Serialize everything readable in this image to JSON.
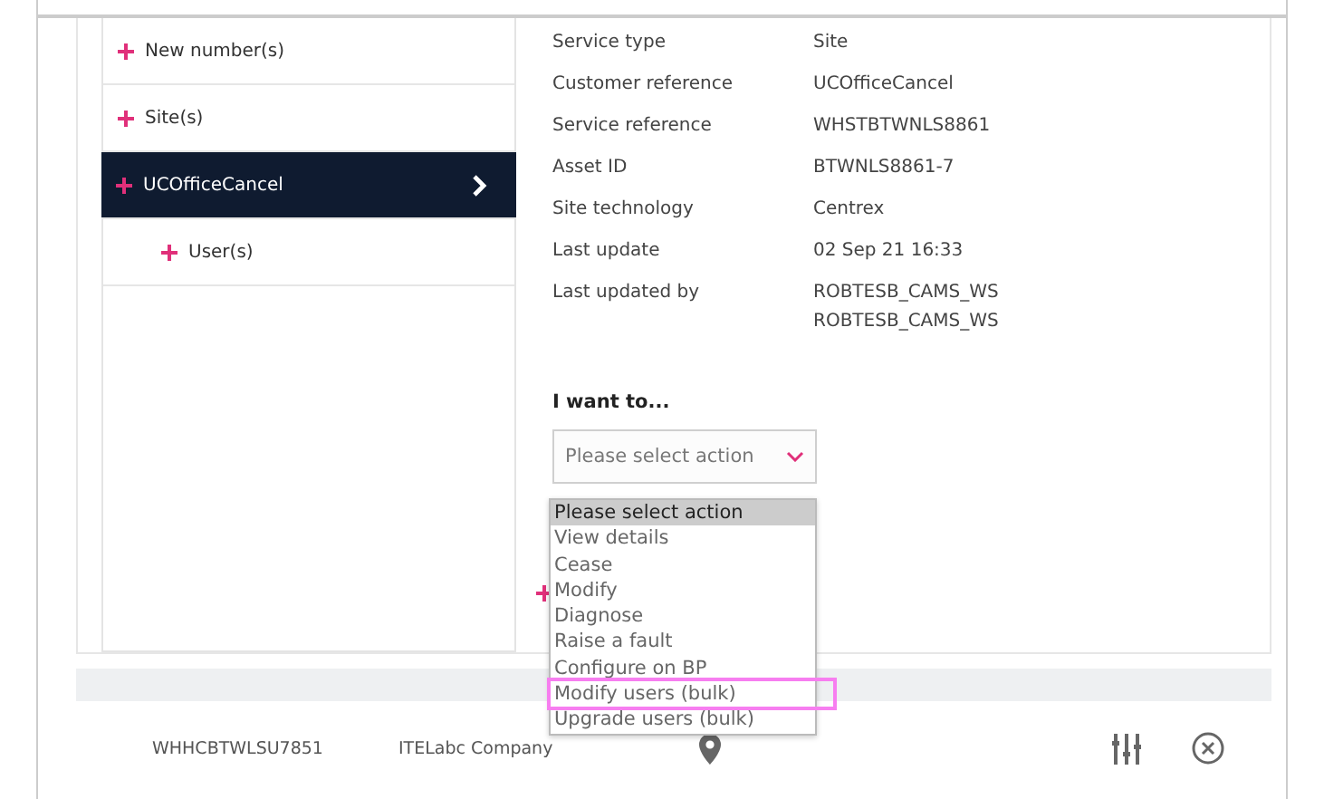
{
  "sidebar": {
    "items": [
      {
        "label": "New number(s)",
        "selected": false
      },
      {
        "label": "Site(s)",
        "selected": false
      },
      {
        "label": "UCOfficeCancel",
        "selected": true,
        "children": [
          {
            "label": "User(s)",
            "selected": false
          }
        ]
      }
    ]
  },
  "details": [
    {
      "label": "Service type",
      "value": [
        "Site"
      ]
    },
    {
      "label": "Customer reference",
      "value": [
        "UCOfficeCancel"
      ]
    },
    {
      "label": "Service reference",
      "value": [
        "WHSTBTWNLS8861"
      ]
    },
    {
      "label": "Asset ID",
      "value": [
        "BTWNLS8861-7"
      ]
    },
    {
      "label": "Site technology",
      "value": [
        "Centrex"
      ]
    },
    {
      "label": "Last update",
      "value": [
        "02 Sep 21 16:33"
      ]
    },
    {
      "label": "Last updated by",
      "value": [
        "ROBTESB_CAMS_WS",
        "ROBTESB_CAMS_WS"
      ]
    }
  ],
  "action": {
    "heading": "I want to...",
    "placeholder": "Please select action",
    "expanded": true,
    "options": [
      {
        "label": "Please select action",
        "selected": true,
        "highlighted": false
      },
      {
        "label": "View details",
        "selected": false,
        "highlighted": false
      },
      {
        "label": "Cease",
        "selected": false,
        "highlighted": false
      },
      {
        "label": "Modify",
        "selected": false,
        "highlighted": false
      },
      {
        "label": "Diagnose",
        "selected": false,
        "highlighted": false
      },
      {
        "label": "Raise a fault",
        "selected": false,
        "highlighted": false
      },
      {
        "label": "Configure on BP",
        "selected": false,
        "highlighted": false
      },
      {
        "label": "Modify users (bulk)",
        "selected": false,
        "highlighted": true
      },
      {
        "label": "Upgrade users (bulk)",
        "selected": false,
        "highlighted": false
      }
    ]
  },
  "footer": {
    "reference": "WHHCBTWLSU7851",
    "company": "ITELabc Company"
  }
}
